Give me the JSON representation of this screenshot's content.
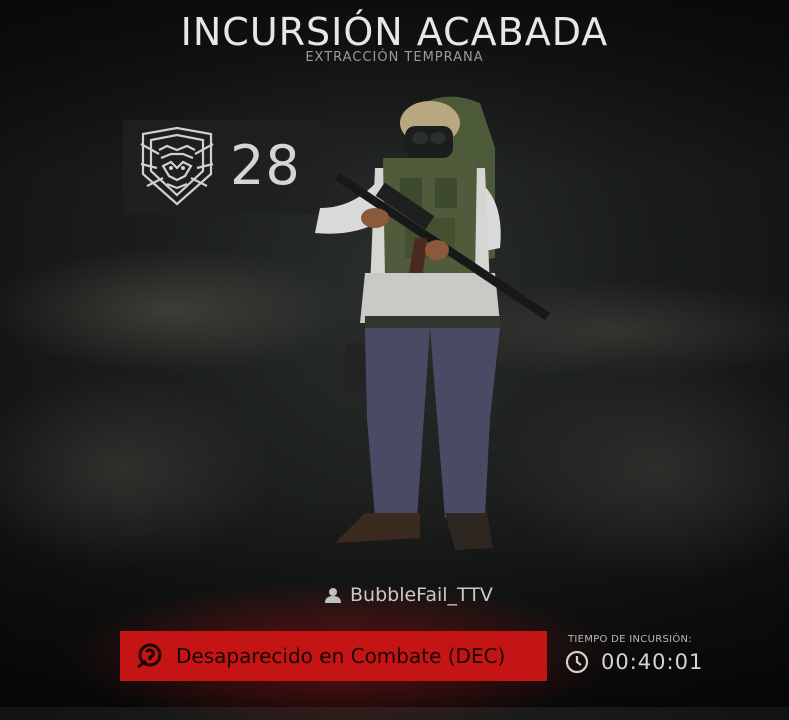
{
  "header": {
    "title": "INCURSIÓN ACABADA",
    "subtitle": "EXTRACCIÓN TEMPRANA"
  },
  "player": {
    "level": "28",
    "level_icon": "level-badge-icon",
    "name": "BubbleFail_TTV",
    "name_icon": "user-icon"
  },
  "status": {
    "text": "Desaparecido en Combate (DEC)",
    "icon": "mia-icon",
    "color": "#c41414"
  },
  "raid_time": {
    "label": "TIEMPO DE INCURSIÓN:",
    "value": "00:40:01",
    "icon": "clock-icon"
  }
}
